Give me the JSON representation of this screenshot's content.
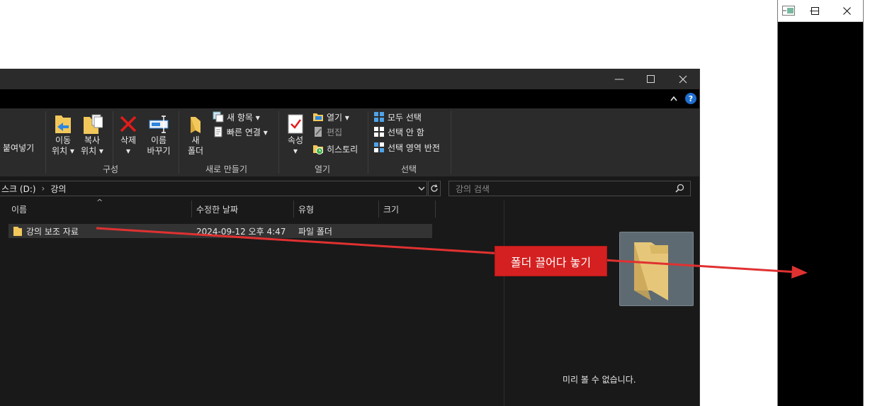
{
  "explorer": {
    "ribbon": {
      "paste_label": "붙여넣기",
      "move_label_1": "이동",
      "move_label_2": "위치 ▾",
      "copy_label_1": "복사",
      "copy_label_2": "위치 ▾",
      "delete_label": "삭제",
      "delete_arrow": "▾",
      "rename_label_1": "이름",
      "rename_label_2": "바꾸기",
      "new_folder_label_1": "새",
      "new_folder_label_2": "폴더",
      "new_item_label": "새 항목 ▾",
      "easy_access_label": "빠른 연결 ▾",
      "properties_label": "속성",
      "properties_arrow": "▾",
      "open_label": "열기 ▾",
      "edit_label": "편집",
      "history_label": "히스토리",
      "select_all_label": "모두 선택",
      "select_none_label": "선택 안 함",
      "invert_selection_label": "선택 영역 반전",
      "group_organize": "구성",
      "group_new": "새로 만들기",
      "group_open": "열기",
      "group_select": "선택"
    },
    "address": {
      "path_partial": "스크 (D:)",
      "separator": "›",
      "folder": "강의",
      "search_placeholder": "강의 검색"
    },
    "columns": {
      "name": "이름",
      "modified": "수정한 날짜",
      "type": "유형",
      "size": "크기"
    },
    "files": [
      {
        "name": "강의 보조 자료",
        "modified": "2024-09-12 오후 4:47",
        "type": "파일 폴더",
        "size": ""
      }
    ],
    "preview_message": "미리 볼 수 없습니다."
  },
  "annotation": {
    "callout_text": "폴더 끌어다 놓기",
    "color": "#d42020"
  },
  "icons": [
    "minimize-icon",
    "maximize-icon",
    "close-icon",
    "chevron-up-icon",
    "help-icon",
    "folder-icon",
    "search-icon",
    "refresh-icon"
  ]
}
